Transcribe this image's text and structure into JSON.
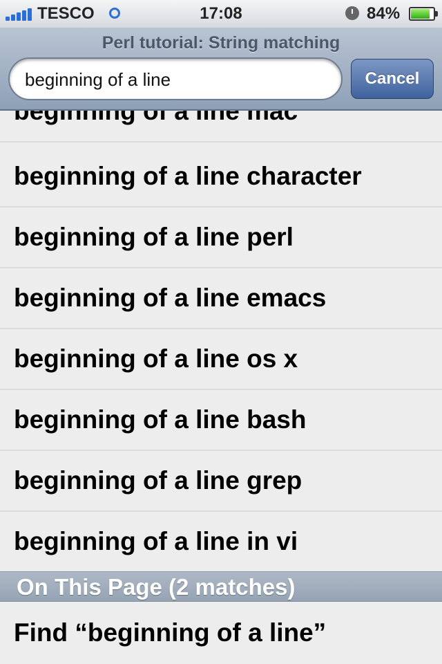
{
  "status_bar": {
    "carrier": "TESCO",
    "time": "17:08",
    "battery_percent": "84%",
    "battery_level": 0.84,
    "signal_icon": "signal-bars-icon",
    "wifi_icon": "wifi-icon",
    "clock_icon": "alarm-clock-icon",
    "battery_icon": "battery-icon"
  },
  "header": {
    "title": "Perl tutorial: String matching",
    "search_value": "beginning of a line",
    "cancel_label": "Cancel"
  },
  "suggestions": [
    "beginning of a line mac",
    "beginning of a line character",
    "beginning of a line perl",
    "beginning of a line emacs",
    "beginning of a line os x",
    "beginning of a line bash",
    "beginning of a line grep",
    "beginning of a line in vi"
  ],
  "on_page": {
    "section_label": "On This Page (2 matches)",
    "find_label": "Find “beginning of a line”"
  },
  "colors": {
    "accent_blue": "#2a6fd6",
    "cancel_button": "#4f6fa8",
    "header_bar": "#9fadc0",
    "list_background": "#ededed"
  }
}
